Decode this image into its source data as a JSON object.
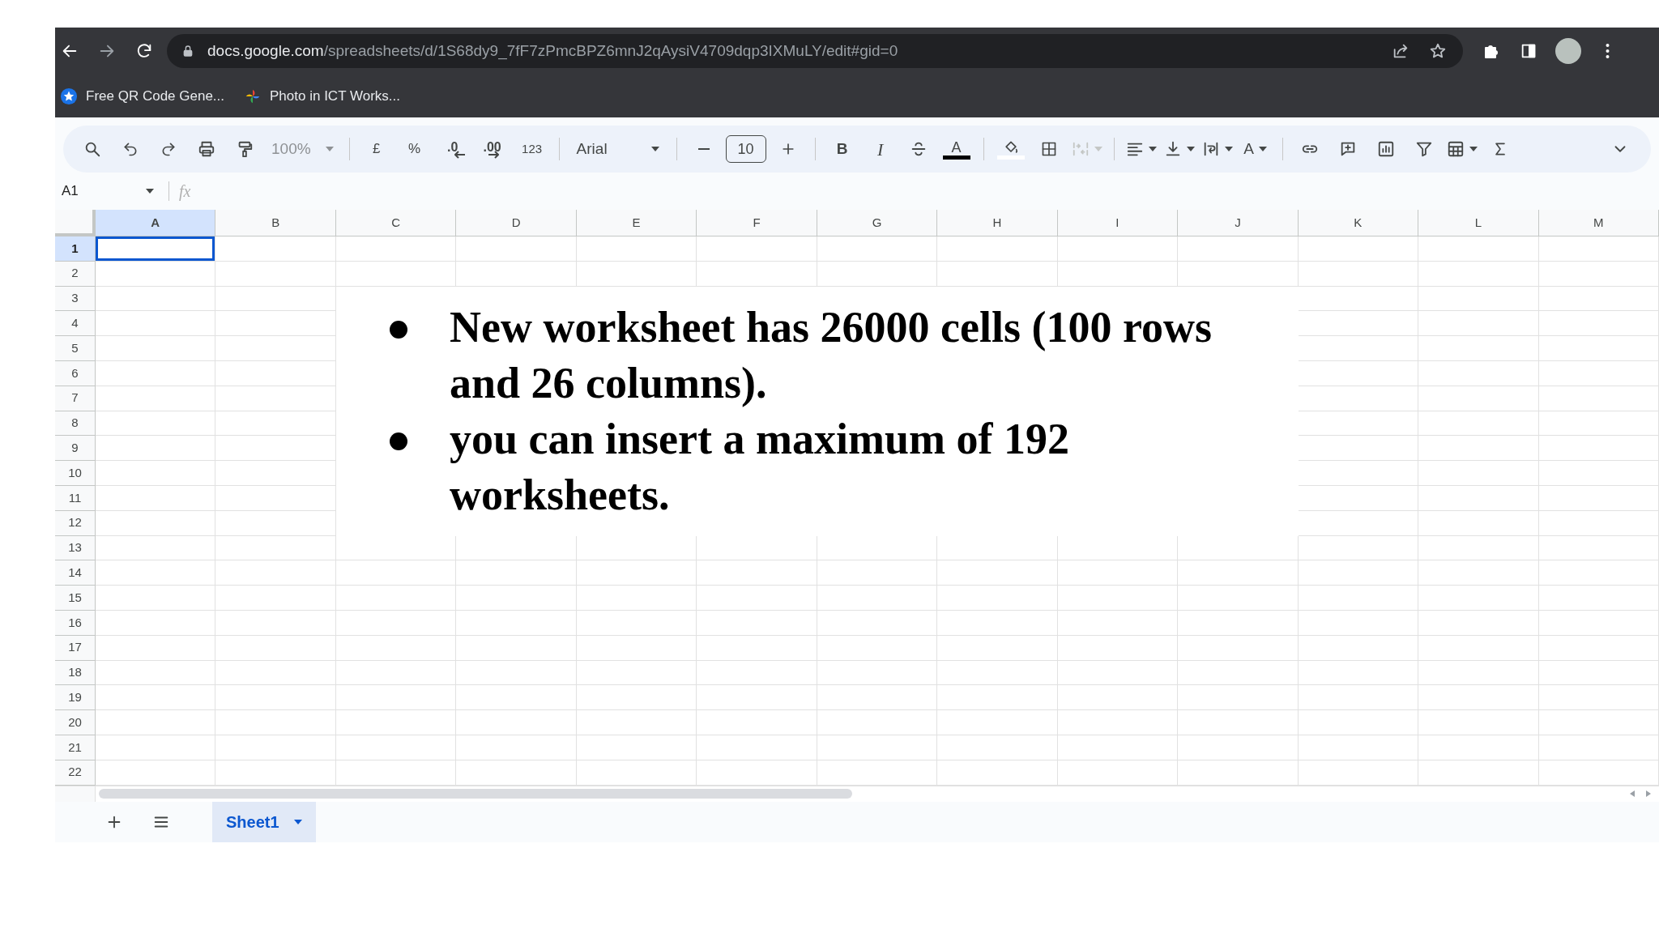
{
  "browser": {
    "url_domain": "docs.google.com",
    "url_path": "/spreadsheets/d/1S68dy9_7fF7zPmcBPZ6mnJ2qAysiV4709dqp3IXMuLY/edit#gid=0",
    "bookmarks": [
      {
        "label": "Free QR Code Gene..."
      },
      {
        "label": "Photo in ICT Works..."
      }
    ]
  },
  "toolbar": {
    "zoom": {
      "label": "100%",
      "disabled": true
    },
    "currency": "£",
    "percent": "%",
    "decrease_decimal": ".0",
    "increase_decimal": ".00",
    "number_format": "123",
    "font": "Arial",
    "font_size": "10",
    "bold": "B",
    "italic": "I",
    "text_color": "A",
    "merge": {
      "disabled": true
    },
    "text_rotation": "A"
  },
  "name_box": "A1",
  "formula_label": "fx",
  "sheet": {
    "columns": [
      {
        "label": "A",
        "selected": true
      },
      {
        "label": "B",
        "selected": false
      },
      {
        "label": "C",
        "selected": false
      },
      {
        "label": "D",
        "selected": false
      },
      {
        "label": "E",
        "selected": false
      },
      {
        "label": "F",
        "selected": false
      },
      {
        "label": "G",
        "selected": false
      },
      {
        "label": "H",
        "selected": false
      },
      {
        "label": "I",
        "selected": false
      },
      {
        "label": "J",
        "selected": false
      },
      {
        "label": "K",
        "selected": false
      },
      {
        "label": "L",
        "selected": false
      },
      {
        "label": "M",
        "selected": false
      }
    ],
    "rows": [
      {
        "label": "1",
        "selected": true
      },
      {
        "label": "2",
        "selected": false
      },
      {
        "label": "3",
        "selected": false
      },
      {
        "label": "4",
        "selected": false
      },
      {
        "label": "5",
        "selected": false
      },
      {
        "label": "6",
        "selected": false
      },
      {
        "label": "7",
        "selected": false
      },
      {
        "label": "8",
        "selected": false
      },
      {
        "label": "9",
        "selected": false
      },
      {
        "label": "10",
        "selected": false
      },
      {
        "label": "11",
        "selected": false
      },
      {
        "label": "12",
        "selected": false
      },
      {
        "label": "13",
        "selected": false
      },
      {
        "label": "14",
        "selected": false
      },
      {
        "label": "15",
        "selected": false
      },
      {
        "label": "16",
        "selected": false
      },
      {
        "label": "17",
        "selected": false
      },
      {
        "label": "18",
        "selected": false
      },
      {
        "label": "19",
        "selected": false
      },
      {
        "label": "20",
        "selected": false
      },
      {
        "label": "21",
        "selected": false
      },
      {
        "label": "22",
        "selected": false
      }
    ]
  },
  "text_box": {
    "bullets": [
      "New worksheet has 26000 cells (100 rows\nand 26 columns).",
      "you can insert a maximum of 192\nworksheets."
    ]
  },
  "sheet_tabs": [
    {
      "label": "Sheet1",
      "selected": true
    }
  ]
}
